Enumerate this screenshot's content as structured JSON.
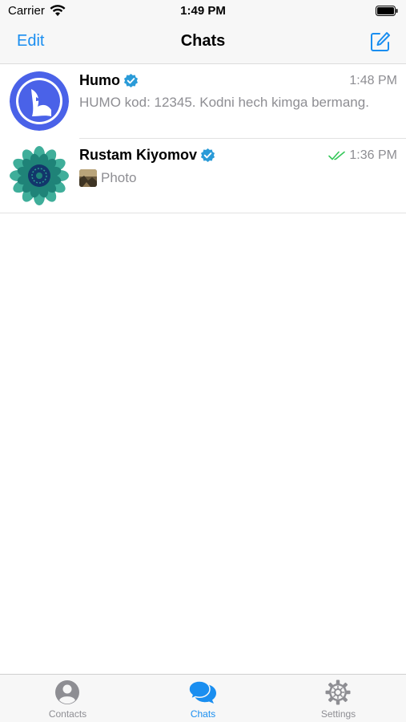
{
  "status_bar": {
    "carrier": "Carrier",
    "time": "1:49 PM",
    "wifi_icon": "wifi-icon",
    "battery_icon": "battery-icon"
  },
  "nav": {
    "edit_label": "Edit",
    "title": "Chats",
    "compose_icon": "compose-icon"
  },
  "chats": [
    {
      "name": "Humo",
      "verified": true,
      "time": "1:48 PM",
      "preview": "HUMO kod: 12345. Kodni hech kimga bermang.",
      "avatar_icon": "humo-logo-avatar",
      "avatar_color": "#4a62e8"
    },
    {
      "name": "Rustam Kiyomov",
      "verified": true,
      "time": "1:36 PM",
      "read_status": "read",
      "preview": "Photo",
      "avatar_icon": "mandala-avatar",
      "avatar_color": "#2a9d8f"
    }
  ],
  "tabs": [
    {
      "label": "Contacts",
      "icon": "person-icon",
      "active": false
    },
    {
      "label": "Chats",
      "icon": "chat-bubbles-icon",
      "active": true
    },
    {
      "label": "Settings",
      "icon": "gear-icon",
      "active": false
    }
  ],
  "colors": {
    "accent": "#1a8ef0",
    "secondary_text": "#8e8e93",
    "read_check": "#34c759",
    "verified": "#2a9bd8"
  }
}
